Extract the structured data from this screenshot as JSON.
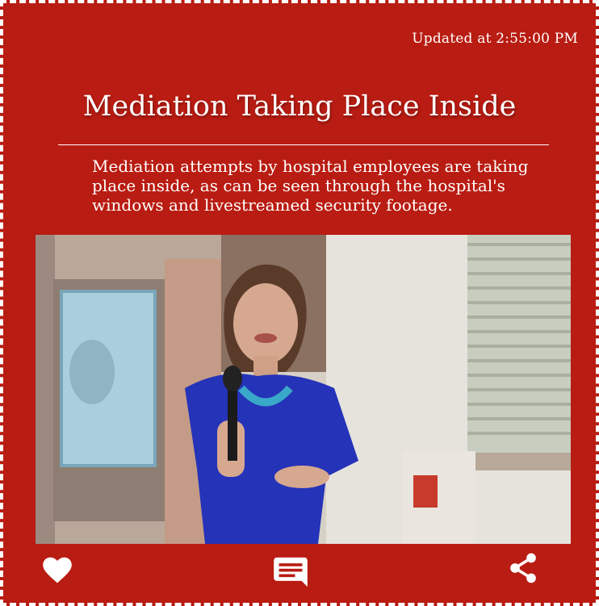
{
  "post": {
    "updated": "Updated at 2:55:00 PM",
    "headline": "Mediation Taking Place Inside",
    "body": "Mediation attempts by hospital employees are taking place inside, as can be seen through the hospital's windows and livestreamed security footage."
  },
  "media": {
    "description_icon": "video-frame"
  },
  "actions": {
    "like_icon": "heart-icon",
    "comment_icon": "comment-icon",
    "share_icon": "share-icon"
  },
  "colors": {
    "background": "#b91c12",
    "text": "#ffffff"
  }
}
